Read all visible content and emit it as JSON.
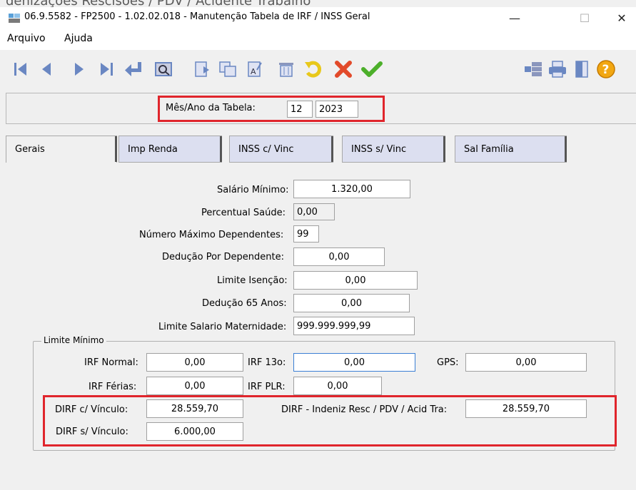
{
  "overlay_text": "denizações Rescisões / PDV / Acidente Trabalho",
  "window": {
    "title": "06.9.5582 - FP2500 - 1.02.02.018 - Manutenção Tabela de IRF / INSS Geral",
    "minimize": "—",
    "maximize": "☐",
    "close": "✕"
  },
  "menu": [
    "Arquivo",
    "Ajuda"
  ],
  "toolbar": {
    "left": [
      "first-record-icon",
      "prev-record-icon",
      "next-record-icon",
      "last-record-icon",
      "return-icon",
      "preview-icon",
      "new-icon",
      "copy-icon",
      "edit-icon",
      "delete-icon",
      "undo-icon",
      "cancel-icon",
      "confirm-icon"
    ],
    "right": [
      "tree-icon",
      "print-icon",
      "exit-icon",
      "help-icon"
    ]
  },
  "header": {
    "label": "Mês/Ano da Tabela:",
    "month": "12",
    "year": "2023"
  },
  "tabs": [
    "Gerais",
    "Imp Renda",
    "INSS c/ Vinc",
    "INSS s/ Vinc",
    "Sal Família"
  ],
  "form": {
    "salario_minimo": {
      "label": "Salário Mínimo:",
      "value": "1.320,00"
    },
    "percentual_saude": {
      "label": "Percentual Saúde:",
      "value": "0,00"
    },
    "numero_max_dependentes": {
      "label": "Número Máximo Dependentes:",
      "value": "99"
    },
    "deducao_dependente": {
      "label": "Dedução Por Dependente:",
      "value": "0,00"
    },
    "limite_isencao": {
      "label": "Limite Isenção:",
      "value": "0,00"
    },
    "deducao_65": {
      "label": "Dedução 65 Anos:",
      "value": "0,00"
    },
    "limite_maternidade": {
      "label": "Limite Salario Maternidade:",
      "value": "999.999.999,99"
    }
  },
  "limite_minimo": {
    "title": "Limite Mínimo",
    "irf_normal": {
      "label": "IRF Normal:",
      "value": "0,00"
    },
    "irf_13": {
      "label": "IRF 13o:",
      "value": "0,00"
    },
    "gps": {
      "label": "GPS:",
      "value": "0,00"
    },
    "irf_ferias": {
      "label": "IRF Férias:",
      "value": "0,00"
    },
    "irf_plr": {
      "label": "IRF PLR:",
      "value": "0,00"
    },
    "dirf_c_vinculo": {
      "label": "DIRF c/ Vínculo:",
      "value": "28.559,70"
    },
    "dirf_indeniz": {
      "label": "DIRF - Indeniz Resc / PDV / Acid Tra:",
      "value": "28.559,70"
    },
    "dirf_s_vinculo": {
      "label": "DIRF s/ Vínculo:",
      "value": "6.000,00"
    }
  },
  "colors": {
    "highlight": "#e0252c",
    "tab_bg": "#dcdff0"
  }
}
